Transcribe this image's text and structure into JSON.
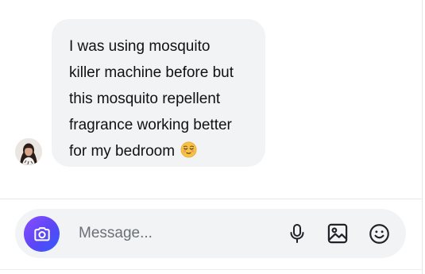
{
  "conversation": {
    "messages": [
      {
        "sender": "contact",
        "lines": [
          "I was using mosquito",
          "killer machine before but",
          "this mosquito repellent",
          "fragrance working better",
          "for my bedroom"
        ],
        "emoji": "😌"
      }
    ]
  },
  "composer": {
    "placeholder": "Message...",
    "camera_icon": "camera-icon",
    "mic_icon": "microphone-icon",
    "image_icon": "image-icon",
    "emoji_icon": "smiley-icon",
    "accent_gradient": [
      "#8b4dff",
      "#2f5cff"
    ]
  }
}
